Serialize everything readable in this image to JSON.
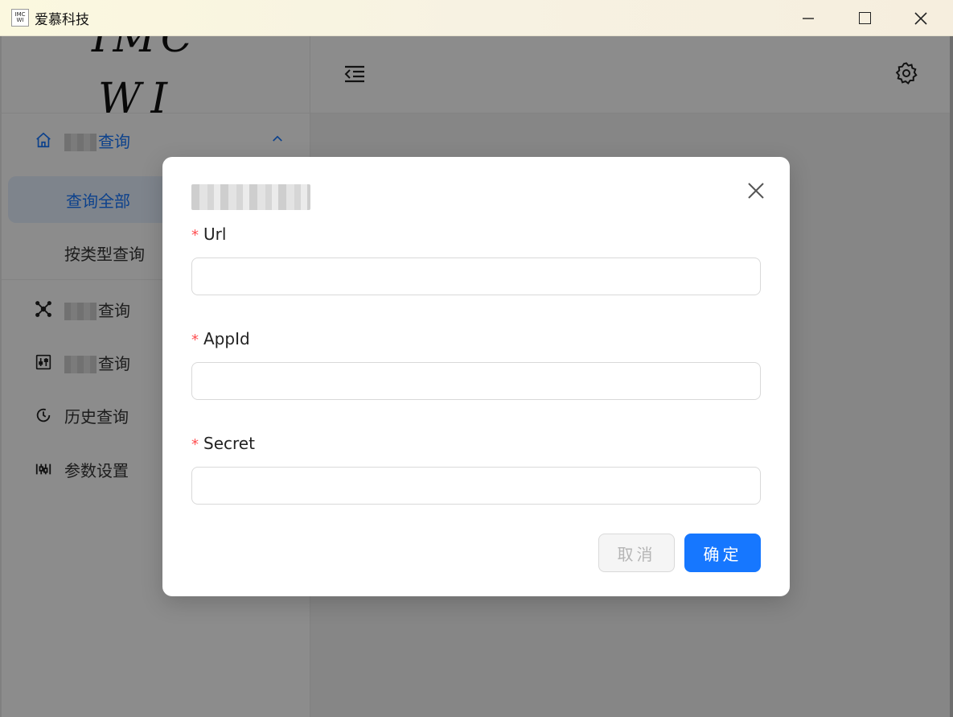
{
  "window": {
    "title": "爱慕科技",
    "icon_label": "IMC WI",
    "controls": {
      "minimize": "—",
      "maximize": "",
      "close": "✕"
    }
  },
  "sidebar": {
    "logo": {
      "line1": "IMC",
      "line2": "WI"
    },
    "menu": {
      "query": {
        "label": "查询",
        "icon": "home-icon",
        "expanded": true
      },
      "query_all": {
        "label": "查询全部",
        "active": true
      },
      "query_by_type": {
        "label": "按类型查询"
      },
      "item_a": {
        "label": "查询",
        "icon": "nodes-icon"
      },
      "item_b": {
        "label": "查询",
        "icon": "sliders-box-icon"
      },
      "history": {
        "label": "历史查询",
        "icon": "history-icon"
      },
      "params": {
        "label": "参数设置",
        "icon": "params-icon"
      }
    }
  },
  "header": {
    "collapse_icon": "menu-collapse-icon",
    "settings_icon": "gear-icon"
  },
  "dialog": {
    "title": "",
    "fields": {
      "url": {
        "label": "Url",
        "value": "",
        "required": true
      },
      "appid": {
        "label": "AppId",
        "value": "",
        "required": true
      },
      "secret": {
        "label": "Secret",
        "value": "",
        "required": true
      }
    },
    "required_mark": "*",
    "cancel_label": "取消",
    "ok_label": "确定"
  },
  "colors": {
    "primary": "#1677ff",
    "required": "#ff4d4f",
    "overlay": "rgba(0,0,0,0.45)"
  }
}
